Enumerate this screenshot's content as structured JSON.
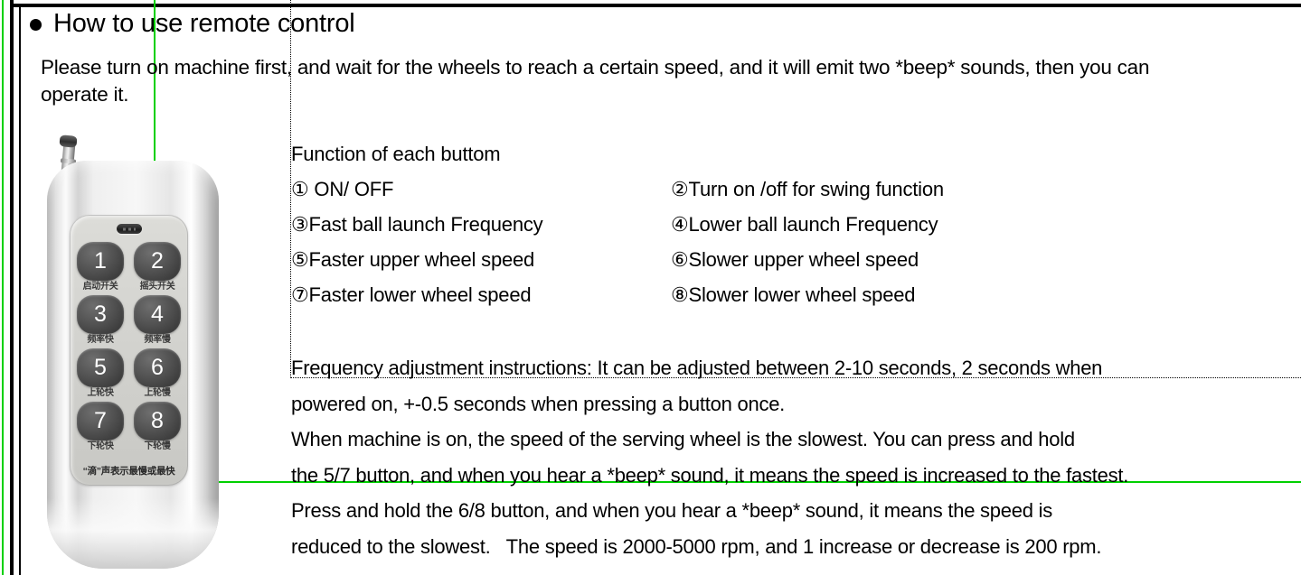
{
  "heading": {
    "bullet": "●",
    "text": "How to use remote control"
  },
  "intro": {
    "text": "Please turn on machine first, and wait for the wheels to reach a certain speed, and it will emit two *beep* sounds, then you can operate it."
  },
  "functions": {
    "title": "Function of each buttom",
    "rows": [
      {
        "left": "① ON/ OFF",
        "right": "②Turn on /off for swing function"
      },
      {
        "left": "③Fast ball launch Frequency",
        "right": "④Lower ball launch Frequency"
      },
      {
        "left": "⑤Faster upper wheel speed",
        "right": "⑥Slower upper wheel speed"
      },
      {
        "left": "⑦Faster lower wheel speed",
        "right": "⑧Slower lower wheel speed"
      }
    ]
  },
  "notes": {
    "lines": [
      "Frequency adjustment instructions: It can be adjusted between 2-10 seconds, 2 seconds when",
      "powered on, +-0.5 seconds when pressing a button once.",
      "When machine is on, the speed of the serving wheel is the slowest. You can press and hold",
      "the 5/7 button, and when you hear a *beep* sound, it means the speed is increased to the fastest.",
      "Press and hold the 6/8 button, and when you hear a *beep* sound, it means the speed is",
      "reduced to the slowest.   The speed is 2000-5000 rpm, and 1 increase or decrease is 200 rpm."
    ]
  },
  "remote": {
    "buttons": [
      {
        "num": "1",
        "label": "启动开关"
      },
      {
        "num": "2",
        "label": "摇头开关"
      },
      {
        "num": "3",
        "label": "频率快"
      },
      {
        "num": "4",
        "label": "频率慢"
      },
      {
        "num": "5",
        "label": "上轮快"
      },
      {
        "num": "6",
        "label": "上轮慢"
      },
      {
        "num": "7",
        "label": "下轮快"
      },
      {
        "num": "8",
        "label": "下轮慢"
      }
    ],
    "footer": "“滴”声表示最慢或最快"
  },
  "colors": {
    "guide_green": "#00d000",
    "frame_black": "#000000",
    "button_dark": "#404040",
    "panel_gray": "#d2d2ce",
    "text_black": "#000000"
  }
}
